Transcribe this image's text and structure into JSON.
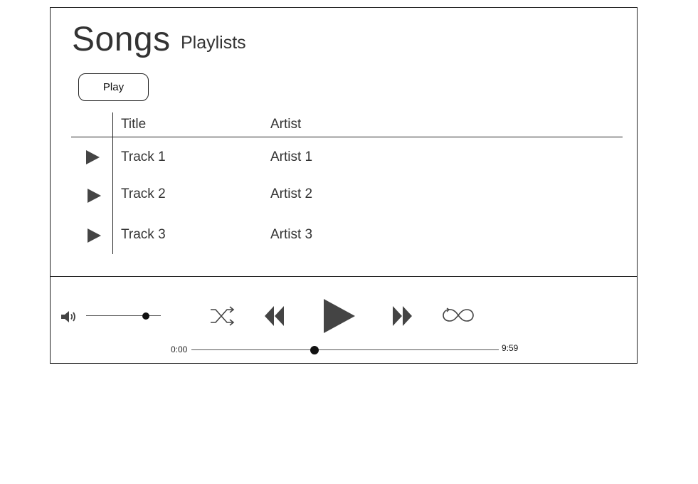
{
  "nav": {
    "songs_tab": "Songs",
    "playlists_tab": "Playlists"
  },
  "toolbar": {
    "play_label": "Play"
  },
  "table": {
    "columns": [
      "Title",
      "Artist"
    ],
    "rows": [
      {
        "title": "Track 1",
        "artist": "Artist 1"
      },
      {
        "title": "Track 2",
        "artist": "Artist 2"
      },
      {
        "title": "Track 3",
        "artist": "Artist 3"
      }
    ]
  },
  "player": {
    "volume_level": 0.8,
    "progress_fraction": 0.4,
    "time_elapsed": "0:00",
    "time_total": "9:59",
    "icons": {
      "volume": "speaker-icon",
      "shuffle": "shuffle-icon",
      "previous": "rewind-icon",
      "play": "play-icon",
      "next": "fast-forward-icon",
      "repeat": "infinity-loop-icon"
    }
  },
  "colors": {
    "icon": "#444444",
    "border": "#222222",
    "text": "#333333"
  }
}
